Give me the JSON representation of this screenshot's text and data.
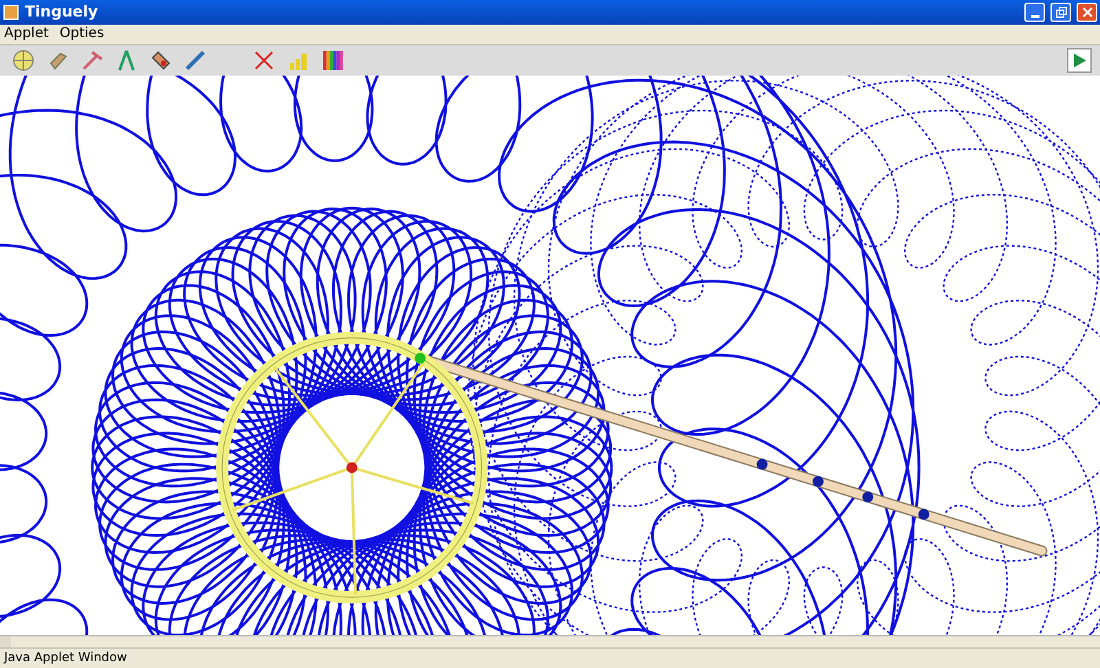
{
  "window": {
    "title": "Tinguely"
  },
  "menu": [
    "Applet",
    "Opties"
  ],
  "toolbar": [
    {
      "kind": "wheel"
    },
    {
      "kind": "tag"
    },
    {
      "kind": "pick"
    },
    {
      "kind": "compass"
    },
    {
      "kind": "eraser"
    },
    {
      "kind": "pen"
    },
    {
      "kind": "gap"
    },
    {
      "kind": "clear"
    },
    {
      "kind": "bars"
    },
    {
      "kind": "colors"
    }
  ],
  "status_bar": {
    "text": "Java Applet Window"
  }
}
